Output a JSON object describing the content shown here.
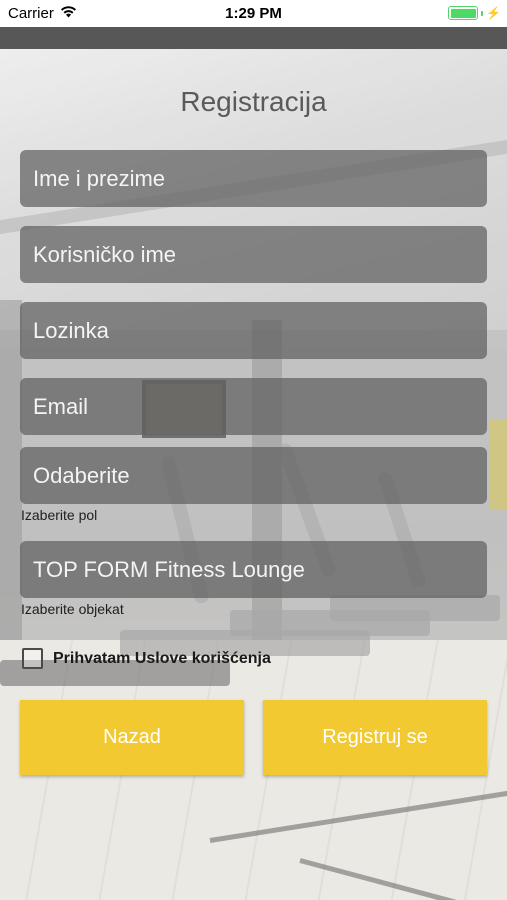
{
  "status_bar": {
    "carrier": "Carrier",
    "time": "1:29 PM",
    "wifi_icon": "wifi-icon",
    "battery_icon": "battery-full-charging-icon",
    "battery_color": "#4cd964"
  },
  "form": {
    "title": "Registracija",
    "fields": {
      "full_name": {
        "placeholder": "Ime i prezime"
      },
      "username": {
        "placeholder": "Korisničko ime"
      },
      "password": {
        "placeholder": "Lozinka"
      },
      "email": {
        "placeholder": "Email"
      },
      "gender": {
        "value": "Odaberite",
        "caption": "Izaberite pol"
      },
      "facility": {
        "value": "TOP FORM Fitness Lounge",
        "caption": "Izaberite objekat"
      }
    },
    "terms": {
      "label": "Prihvatam Uslove korišćenja",
      "checked": false
    },
    "buttons": {
      "back": "Nazad",
      "register": "Registruj se"
    }
  },
  "colors": {
    "accent": "#f2c931",
    "field_bg": "#5f5f5f",
    "navbar": "#575757"
  }
}
